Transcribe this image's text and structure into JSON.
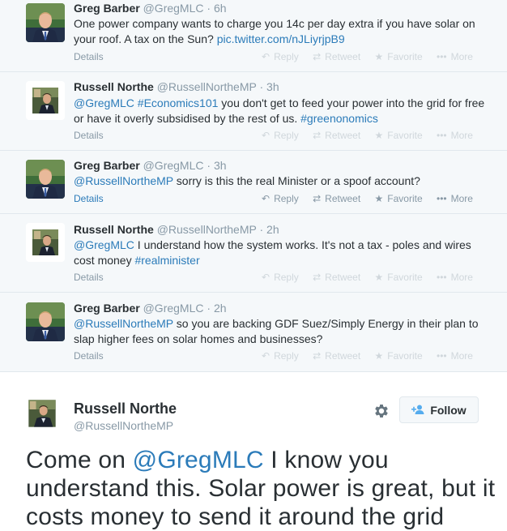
{
  "tweets": [
    {
      "name": "Greg Barber",
      "handle": "@GregMLC",
      "time": "6h",
      "text_parts": [
        "One power company wants to charge you 14c per day extra if you have solar on your roof. A tax on the Sun? "
      ],
      "link": "pic.twitter.com/nJLiyrjpB9",
      "details": "Details",
      "actions": {
        "reply": "Reply",
        "retweet": "Retweet",
        "favorite": "Favorite",
        "more": "More"
      }
    },
    {
      "name": "Russell Northe",
      "handle": "@RussellNortheMP",
      "time": "3h",
      "mention": "@GregMLC",
      "hashtag1": "#Economics101",
      "text_mid": " you don't get to feed your power into the grid for free or have it overly subsidised by the rest of us. ",
      "hashtag2": "#greenonomics",
      "details": "Details",
      "actions": {
        "reply": "Reply",
        "retweet": "Retweet",
        "favorite": "Favorite",
        "more": "More"
      }
    },
    {
      "name": "Greg Barber",
      "handle": "@GregMLC",
      "time": "3h",
      "mention": "@RussellNortheMP",
      "text_rest": " sorry is this the real Minister or a spoof account?",
      "details": "Details",
      "actions": {
        "reply": "Reply",
        "retweet": "Retweet",
        "favorite": "Favorite",
        "more": "More"
      }
    },
    {
      "name": "Russell Northe",
      "handle": "@RussellNortheMP",
      "time": "2h",
      "mention": "@GregMLC",
      "text_rest": " I understand how the system works. It's not a tax - poles and wires cost money ",
      "hashtag": "#realminister",
      "details": "Details",
      "actions": {
        "reply": "Reply",
        "retweet": "Retweet",
        "favorite": "Favorite",
        "more": "More"
      }
    },
    {
      "name": "Greg Barber",
      "handle": "@GregMLC",
      "time": "2h",
      "mention": "@RussellNortheMP",
      "text_rest": " so you are backing GDF Suez/Simply Energy in their plan to slap higher fees on solar homes and businesses?",
      "details": "Details",
      "actions": {
        "reply": "Reply",
        "retweet": "Retweet",
        "favorite": "Favorite",
        "more": "More"
      }
    }
  ],
  "focused": {
    "name": "Russell Northe",
    "handle": "@RussellNortheMP",
    "follow_label": "Follow",
    "text_start": "Come on ",
    "mention": "@GregMLC",
    "text_rest": " I know you understand this. Solar power is great, but it costs money to send it around the grid"
  },
  "colors": {
    "link": "#2b7bb9",
    "muted": "#8899a6",
    "background_stream": "#f5f8fa",
    "text": "#292f33"
  },
  "icons": {
    "reply": "reply-icon",
    "retweet": "retweet-icon",
    "favorite": "star-icon",
    "more": "ellipsis-icon",
    "settings": "gear-icon",
    "follow": "add-person-icon"
  },
  "separator": " · "
}
